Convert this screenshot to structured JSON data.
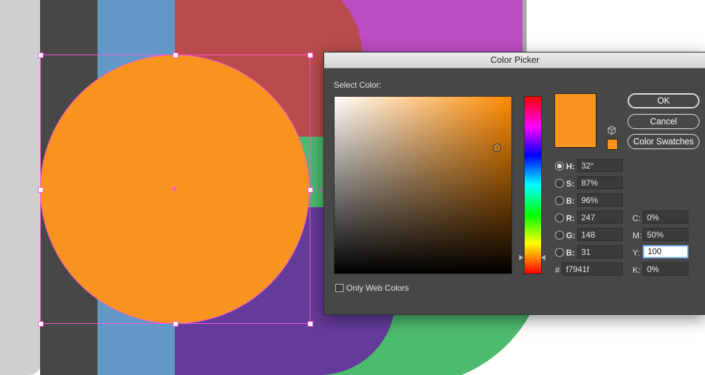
{
  "dialog": {
    "title": "Color Picker",
    "select_color_label": "Select Color:",
    "buttons": {
      "ok": "OK",
      "cancel": "Cancel",
      "swatches": "Color Swatches"
    },
    "only_web_colors_label": "Only Web Colors",
    "only_web_colors_checked": false,
    "current_color": "#f7941f",
    "hsb": [
      {
        "label": "H:",
        "value": "32°",
        "selected": true
      },
      {
        "label": "S:",
        "value": "87%",
        "selected": false
      },
      {
        "label": "B:",
        "value": "96%",
        "selected": false
      }
    ],
    "rgb": [
      {
        "label": "R:",
        "value": "247"
      },
      {
        "label": "G:",
        "value": "148"
      },
      {
        "label": "B:",
        "value": "31"
      }
    ],
    "hex": {
      "label": "#",
      "value": "f7941f"
    },
    "cmyk": [
      {
        "label": "C:",
        "value": "0%"
      },
      {
        "label": "M:",
        "value": "50%"
      },
      {
        "label": "Y:",
        "value": "100"
      },
      {
        "label": "K:",
        "value": "0%"
      }
    ]
  },
  "artwork": {
    "selected_circle_color": "#f7941f",
    "selection_color": "#ff55d8"
  }
}
